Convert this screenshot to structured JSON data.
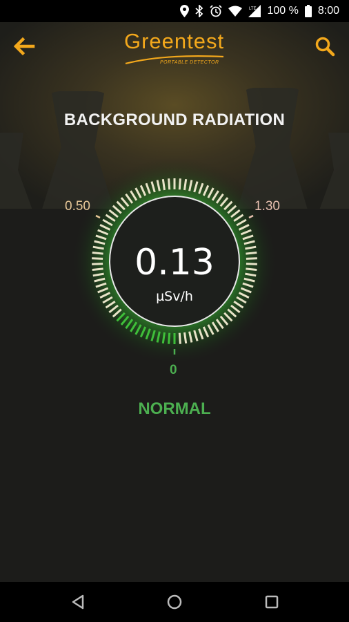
{
  "status_bar": {
    "battery": "100 %",
    "time": "8:00",
    "icons": [
      "location-icon",
      "bluetooth-icon",
      "alarm-icon",
      "wifi-icon",
      "lte-signal-icon",
      "battery-icon"
    ]
  },
  "app_bar": {
    "logo_text": "Greentest",
    "logo_subtitle": "PORTABLE DETECTOR",
    "back_icon": "arrow-left-icon",
    "search_icon": "search-icon"
  },
  "screen": {
    "title": "BACKGROUND RADIATION",
    "gauge": {
      "min_label": "0.50",
      "max_label": "1.30",
      "zero_label": "0",
      "value": "0.13",
      "unit": "µSv/h",
      "level_fraction": 0.13
    },
    "status": "NORMAL"
  },
  "nav_bar": {
    "icons": [
      "back-triangle-icon",
      "home-circle-icon",
      "recents-square-icon"
    ]
  },
  "colors": {
    "accent": "#f3a81c",
    "normal": "#4caf50",
    "background": "#1c1c1a"
  }
}
